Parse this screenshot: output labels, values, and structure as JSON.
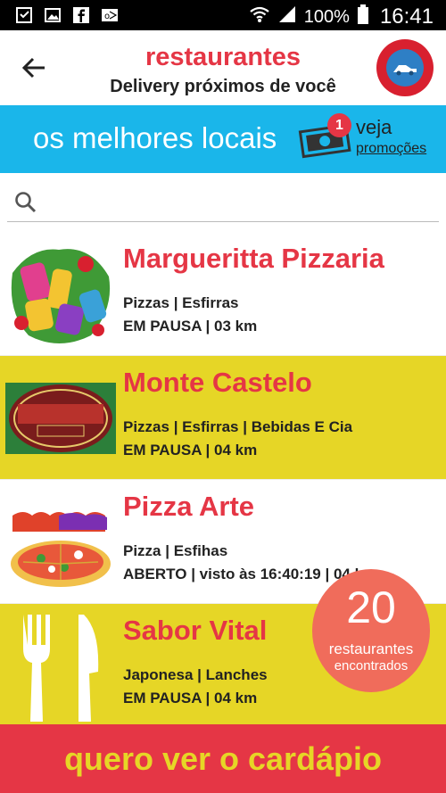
{
  "status_bar": {
    "battery": "100%",
    "time": "16:41"
  },
  "header": {
    "title": "restaurantes",
    "subtitle": "Delivery próximos de você"
  },
  "banner": {
    "text": "os melhores locais",
    "badge_count": "1",
    "veja": "veja",
    "promocoes": "promoções"
  },
  "search": {
    "placeholder": ""
  },
  "restaurants": [
    {
      "name": "Margueritta Pizzaria",
      "categories": "Pizzas | Esfirras",
      "status": "EM PAUSA | 03 km"
    },
    {
      "name": "Monte Castelo",
      "categories": "Pizzas | Esfirras | Bebidas E Cia",
      "status": "EM PAUSA | 04 km"
    },
    {
      "name": "Pizza Arte",
      "categories": "Pizza | Esfihas",
      "status": "ABERTO | visto às 16:40:19 | 04 km"
    },
    {
      "name": "Sabor Vital",
      "categories": "Japonesa | Lanches",
      "status": "EM PAUSA | 04 km"
    }
  ],
  "counter": {
    "number": "20",
    "line1": "restaurantes",
    "line2": "encontrados"
  },
  "cta": {
    "label": "quero ver o cardápio"
  },
  "colors": {
    "accent_red": "#e53645",
    "banner_blue": "#1ab6ea",
    "row_yellow": "#e6d626",
    "counter_coral": "#f06c5b"
  }
}
